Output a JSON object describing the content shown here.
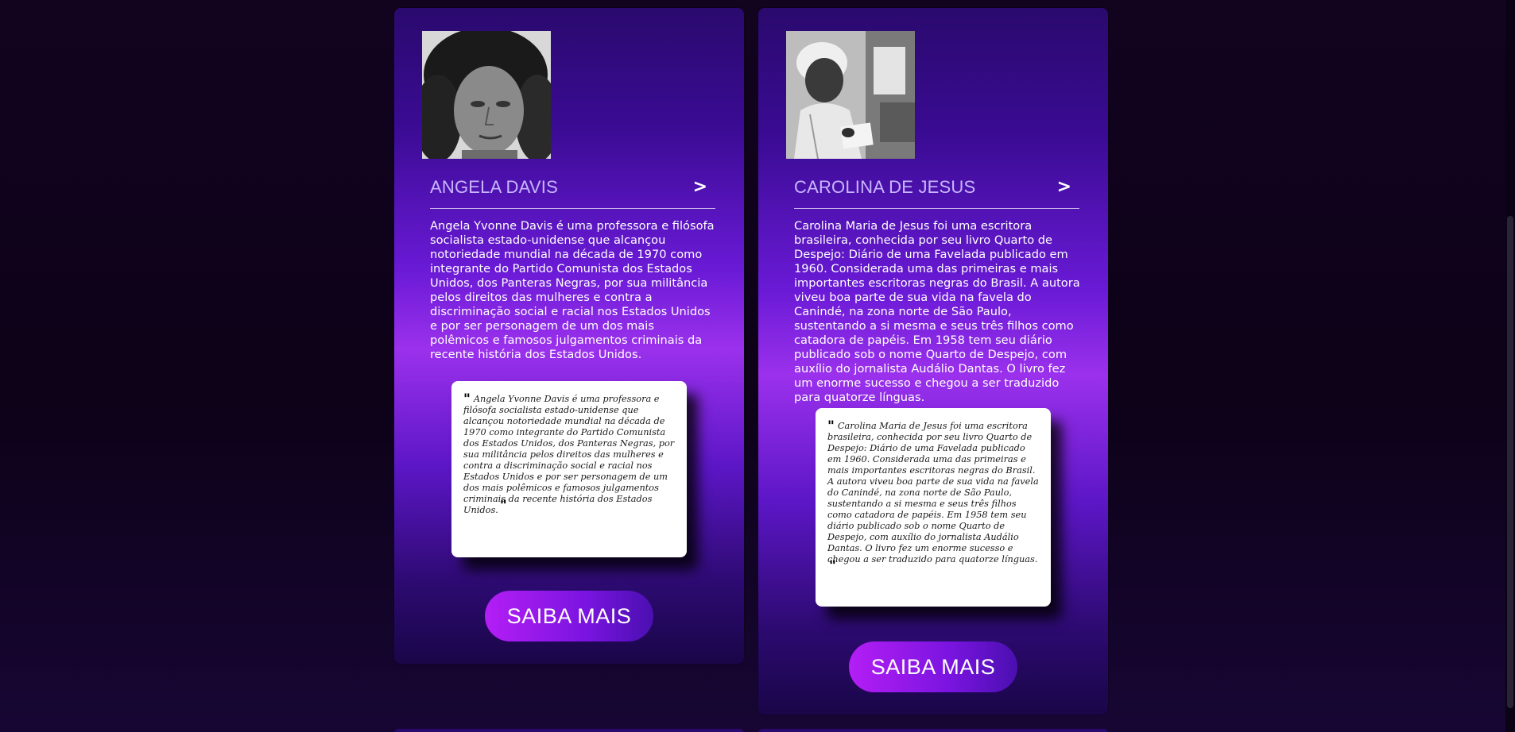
{
  "cards": [
    {
      "name": "ANGELA DAVIS",
      "arrow": ">",
      "photo_alt": "Angela Davis",
      "description": "Angela Yvonne Davis é uma professora e filósofa socialista estado-unidense que alcançou notoriedade mundial na década de 1970 como integrante do Partido Comunista dos Estados Unidos, dos Panteras Negras, por sua militância pelos direitos das mulheres e contra a discriminação social e racial nos Estados Unidos e por ser personagem de um dos mais polêmicos e famosos julgamentos criminais da recente história dos Estados Unidos.",
      "quote": "Angela Yvonne Davis é uma professora e filósofa socialista estado-unidense que alcançou notoriedade mundial na década de 1970 como integrante do Partido Comunista dos Estados Unidos, dos Panteras Negras, por sua militância pelos direitos das mulheres e contra a discriminação social e racial nos Estados Unidos e por ser personagem de um dos mais polêmicos e famosos julgamentos criminais da recente história dos Estados Unidos.",
      "quote_open": "\"",
      "quote_close": "\"",
      "button_label": "SAIBA MAIS"
    },
    {
      "name": "CAROLINA DE JESUS",
      "arrow": ">",
      "photo_alt": "Carolina de Jesus",
      "description": "Carolina Maria de Jesus foi uma escritora brasileira, conhecida por seu livro Quarto de Despejo: Diário de uma Favelada publicado em 1960. Considerada uma das primeiras e mais importantes escritoras negras do Brasil. A autora viveu boa parte de sua vida na favela do Canindé, na zona norte de São Paulo, sustentando a si mesma e seus três filhos como catadora de papéis. Em 1958 tem seu diário publicado sob o nome Quarto de Despejo, com auxílio do jornalista Audálio Dantas. O livro fez um enorme sucesso e chegou a ser traduzido para quatorze línguas.",
      "quote": "Carolina Maria de Jesus foi uma escritora brasileira, conhecida por seu livro Quarto de Despejo: Diário de uma Favelada publicado em 1960. Considerada uma das primeiras e mais importantes escritoras negras do Brasil. A autora viveu boa parte de sua vida na favela do Canindé, na zona norte de São Paulo, sustentando a si mesma e seus três filhos como catadora de papéis. Em 1958 tem seu diário publicado sob o nome Quarto de Despejo, com auxílio do jornalista Audálio Dantas. O livro fez um enorme sucesso e chegou a ser traduzido para quatorze línguas.",
      "quote_open": "\"",
      "quote_close": "\"",
      "button_label": "SAIBA MAIS"
    }
  ],
  "colors": {
    "card_gradient_top": "#2a0a6e",
    "card_gradient_mid": "#9b31ec",
    "name_color": "#c8b6ff",
    "button_start": "#b41ef5",
    "button_end": "#4a0fb0",
    "page_background": "#12031f"
  }
}
